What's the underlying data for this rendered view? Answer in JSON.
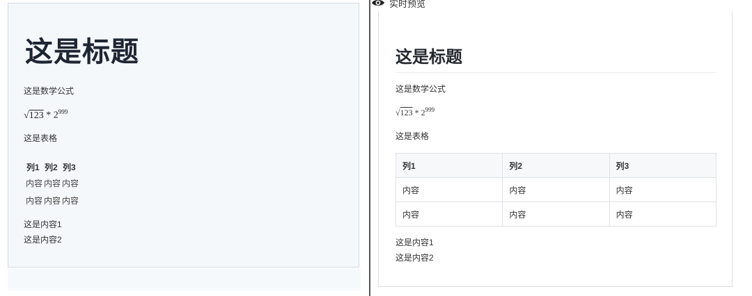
{
  "editor": {
    "title": "这是标题",
    "math_label": "这是数学公式",
    "formula": {
      "radicand": "123",
      "operator": "*",
      "base": "2",
      "exponent": "999"
    },
    "table_label": "这是表格",
    "table": {
      "headers": [
        "列1",
        "列2",
        "列3"
      ],
      "rows": [
        [
          "内容",
          "内容",
          "内容"
        ],
        [
          "内容",
          "内容",
          "内容"
        ]
      ]
    },
    "content1": "这是内容1",
    "content2": "这是内容2"
  },
  "preview": {
    "header_label": "实时预览",
    "header_icon": "eye-icon",
    "title": "这是标题",
    "math_label": "这是数学公式",
    "formula": {
      "radicand": "123",
      "operator": "*",
      "base": "2",
      "exponent": "999"
    },
    "table_label": "这是表格",
    "table": {
      "headers": [
        "列1",
        "列2",
        "列3"
      ],
      "rows": [
        [
          "内容",
          "内容",
          "内容"
        ],
        [
          "内容",
          "内容",
          "内容"
        ]
      ]
    },
    "content1": "这是内容1",
    "content2": "这是内容2"
  },
  "colors": {
    "editor_bg": "#f5f8fb",
    "title_text": "#1e2633",
    "table_header_bg": "#f6f8fa",
    "border": "#dfe2e5"
  }
}
